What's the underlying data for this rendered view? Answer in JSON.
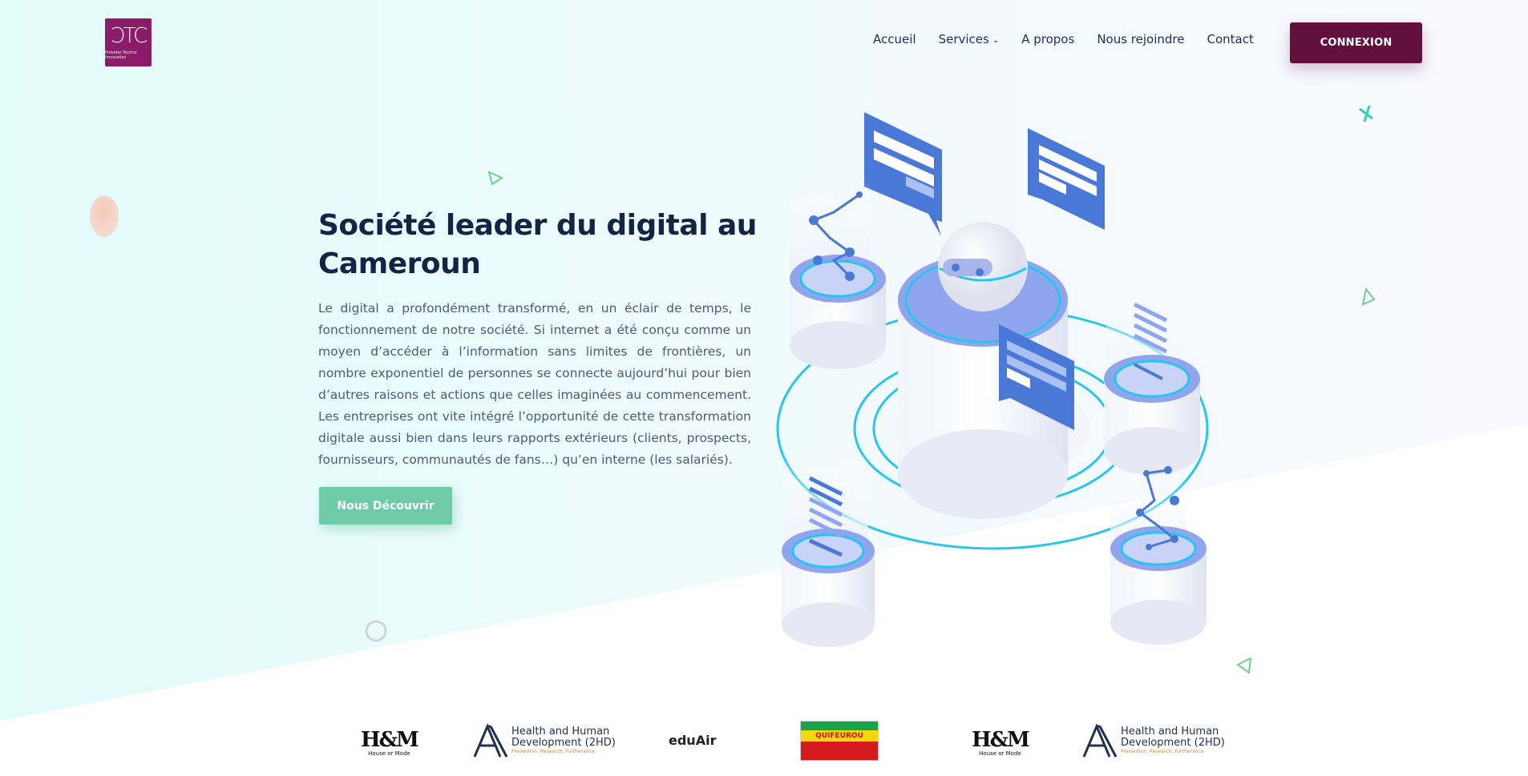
{
  "header": {
    "logo": {
      "mark": "ƆTC",
      "tagline": "Provider Techno Innovation"
    },
    "nav": [
      {
        "label": "Accueil",
        "icon": null
      },
      {
        "label": "Services",
        "icon": "chevron-down-icon"
      },
      {
        "label": "A propos",
        "icon": null
      },
      {
        "label": "Nous rejoindre",
        "icon": null
      },
      {
        "label": "Contact",
        "icon": null
      }
    ],
    "login_label": "CONNEXION"
  },
  "hero": {
    "title": "Société leader du digital au Cameroun",
    "text": "Le digital a profondément transformé, en un éclair de temps, le fonctionnement de notre société. Si internet a été conçu comme un moyen d’accéder à l’information sans limites de frontières, un nombre exponentiel de personnes se connecte aujourd’hui pour bien d’autres raisons et actions que celles imaginées au commencement. Les entreprises ont vite intégré l’opportunité de cette transformation digitale aussi bien dans leurs rapports extérieurs (clients, prospects, fournisseurs, communautés de fans…) qu’en interne (les salariés).",
    "cta_label": "Nous Découvrir"
  },
  "partners": [
    {
      "name": "H&M",
      "sub": "House or Mode"
    },
    {
      "name": "Health and Human Development (2HD)",
      "line1": "Health and Human",
      "line2": "Development (2HD)",
      "sub": "Prevention, Research, Furtherance"
    },
    {
      "name": "eduAir"
    },
    {
      "name": "QUIFEUROU"
    },
    {
      "name": "H&M",
      "sub": "House or Mode"
    },
    {
      "name": "Health and Human Development (2HD)",
      "line1": "Health and Human",
      "line2": "Development (2HD)",
      "sub": "Prevention, Research, Furtherance"
    }
  ],
  "colors": {
    "brand": "#8c1c6a",
    "login": "#64103f",
    "cta": "#6ecaa8",
    "accent_blue": "#4a78d6",
    "ring": "#27c6ec"
  }
}
